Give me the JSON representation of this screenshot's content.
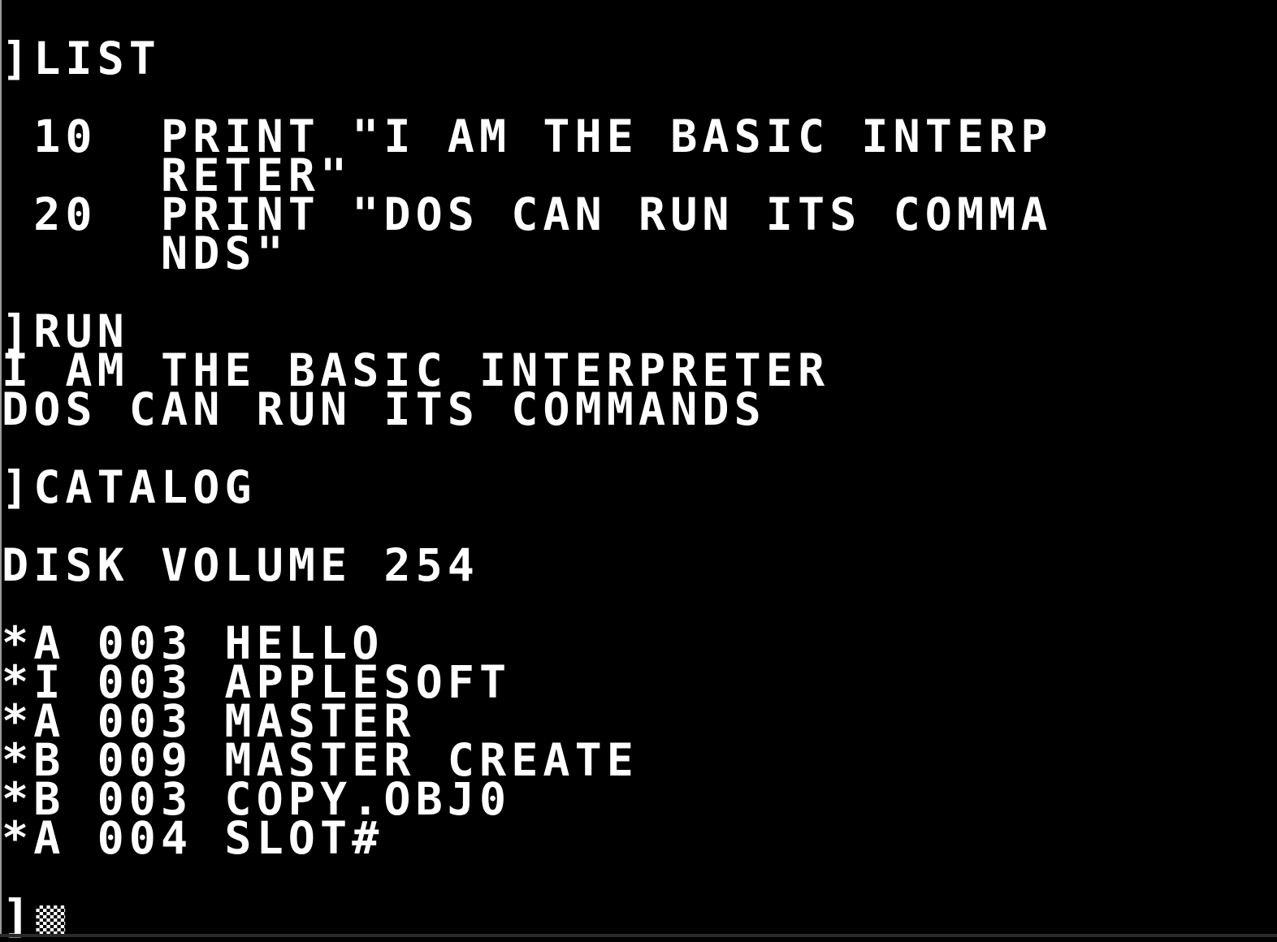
{
  "app": "Apple II Emulator - DOS 3.3 Text Screen",
  "screen": {
    "background": "#000000",
    "foreground": "#ffffff",
    "columns": 40,
    "rows": [
      {
        "row": 1,
        "text": "]LIST"
      },
      {
        "row": 3,
        "text": " 10  PRINT \"I AM THE BASIC INTERP"
      },
      {
        "row": 4,
        "text": "     RETER\""
      },
      {
        "row": 5,
        "text": " 20  PRINT \"DOS CAN RUN ITS COMMA"
      },
      {
        "row": 6,
        "text": "     NDS\""
      },
      {
        "row": 8,
        "text": "]RUN"
      },
      {
        "row": 9,
        "text": "I AM THE BASIC INTERPRETER"
      },
      {
        "row": 10,
        "text": "DOS CAN RUN ITS COMMANDS"
      },
      {
        "row": 12,
        "text": "]CATALOG"
      },
      {
        "row": 14,
        "text": "DISK VOLUME 254"
      },
      {
        "row": 16,
        "text": "*A 003 HELLO"
      },
      {
        "row": 17,
        "text": "*I 003 APPLESOFT"
      },
      {
        "row": 18,
        "text": "*A 003 MASTER"
      },
      {
        "row": 19,
        "text": "*B 009 MASTER CREATE"
      },
      {
        "row": 20,
        "text": "*B 003 COPY.OBJ0"
      },
      {
        "row": 21,
        "text": "*A 004 SLOT#"
      }
    ],
    "prompt": {
      "row": 23,
      "text": "]",
      "cursor": "checkerboard-cursor"
    }
  }
}
